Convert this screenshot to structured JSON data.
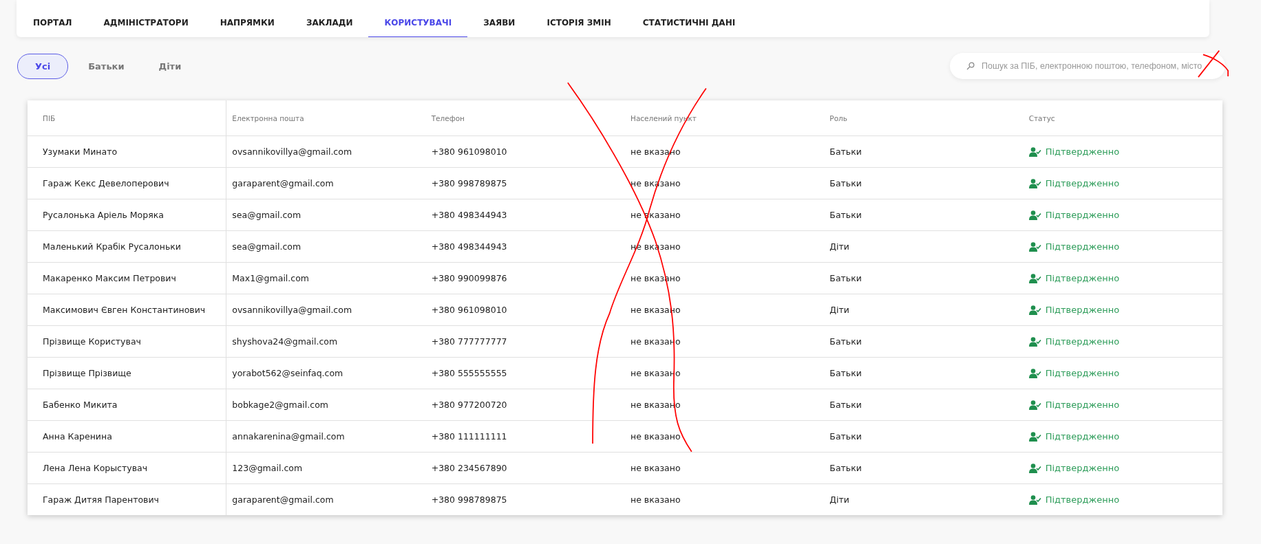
{
  "nav_tabs": [
    {
      "label": "ПОРТАЛ",
      "selected": false
    },
    {
      "label": "АДМІНІСТРАТОРИ",
      "selected": false
    },
    {
      "label": "НАПРЯМКИ",
      "selected": false
    },
    {
      "label": "ЗАКЛАДИ",
      "selected": false
    },
    {
      "label": "КОРИСТУВАЧІ",
      "selected": true
    },
    {
      "label": "ЗАЯВИ",
      "selected": false
    },
    {
      "label": "ІСТОРІЯ ЗМІН",
      "selected": false
    },
    {
      "label": "СТАТИСТИЧНІ ДАНІ",
      "selected": false
    }
  ],
  "filters": [
    {
      "label": "Усі",
      "selected": true
    },
    {
      "label": "Батьки",
      "selected": false
    },
    {
      "label": "Діти",
      "selected": false
    }
  ],
  "search": {
    "placeholder": "Пошук за ПІБ, електронною поштою, телефоном, місто"
  },
  "table": {
    "columns": [
      "ПІБ",
      "Електронна пошта",
      "Телефон",
      "Населений пункт",
      "Роль",
      "Статус"
    ],
    "rows": [
      {
        "name": "Узумаки Минато",
        "email": "ovsannikovillya@gmail.com",
        "phone": "+380 961098010",
        "city": "не вказано",
        "role": "Батьки",
        "status": "Підтвердженно"
      },
      {
        "name": "Гараж Кекс Девелоперович",
        "email": "garaparent@gmail.com",
        "phone": "+380 998789875",
        "city": "не вказано",
        "role": "Батьки",
        "status": "Підтвердженно"
      },
      {
        "name": "Русалонька Аріель Моряка",
        "email": "sea@gmail.com",
        "phone": "+380 498344943",
        "city": "не вказано",
        "role": "Батьки",
        "status": "Підтвердженно"
      },
      {
        "name": "Маленький Крабік Русалоньки",
        "email": "sea@gmail.com",
        "phone": "+380 498344943",
        "city": "не вказано",
        "role": "Діти",
        "status": "Підтвердженно"
      },
      {
        "name": "Макаренко Максим Петрович",
        "email": "Max1@gmail.com",
        "phone": "+380 990099876",
        "city": "не вказано",
        "role": "Батьки",
        "status": "Підтвердженно"
      },
      {
        "name": "Максимович Євген Константинович",
        "email": "ovsannikovillya@gmail.com",
        "phone": "+380 961098010",
        "city": "не вказано",
        "role": "Діти",
        "status": "Підтвердженно"
      },
      {
        "name": "Прізвище Користувач",
        "email": "shyshova24@gmail.com",
        "phone": "+380 777777777",
        "city": "не вказано",
        "role": "Батьки",
        "status": "Підтвердженно"
      },
      {
        "name": "Прізвище Прізвище",
        "email": "yorabot562@seinfaq.com",
        "phone": "+380 555555555",
        "city": "не вказано",
        "role": "Батьки",
        "status": "Підтвердженно"
      },
      {
        "name": "Бабенко Микита",
        "email": "bobkage2@gmail.com",
        "phone": "+380 977200720",
        "city": "не вказано",
        "role": "Батьки",
        "status": "Підтвердженно"
      },
      {
        "name": "Анна Каренина",
        "email": "annakarenina@gmail.com",
        "phone": "+380 111111111",
        "city": "не вказано",
        "role": "Батьки",
        "status": "Підтвердженно"
      },
      {
        "name": "Лена Лена Корыстувач",
        "email": "123@gmail.com",
        "phone": "+380 234567890",
        "city": "не вказано",
        "role": "Батьки",
        "status": "Підтвердженно"
      },
      {
        "name": "Гараж Дитяя Парентович",
        "email": "garaparent@gmail.com",
        "phone": "+380 998789875",
        "city": "не вказано",
        "role": "Діти",
        "status": "Підтвердженно"
      }
    ]
  }
}
